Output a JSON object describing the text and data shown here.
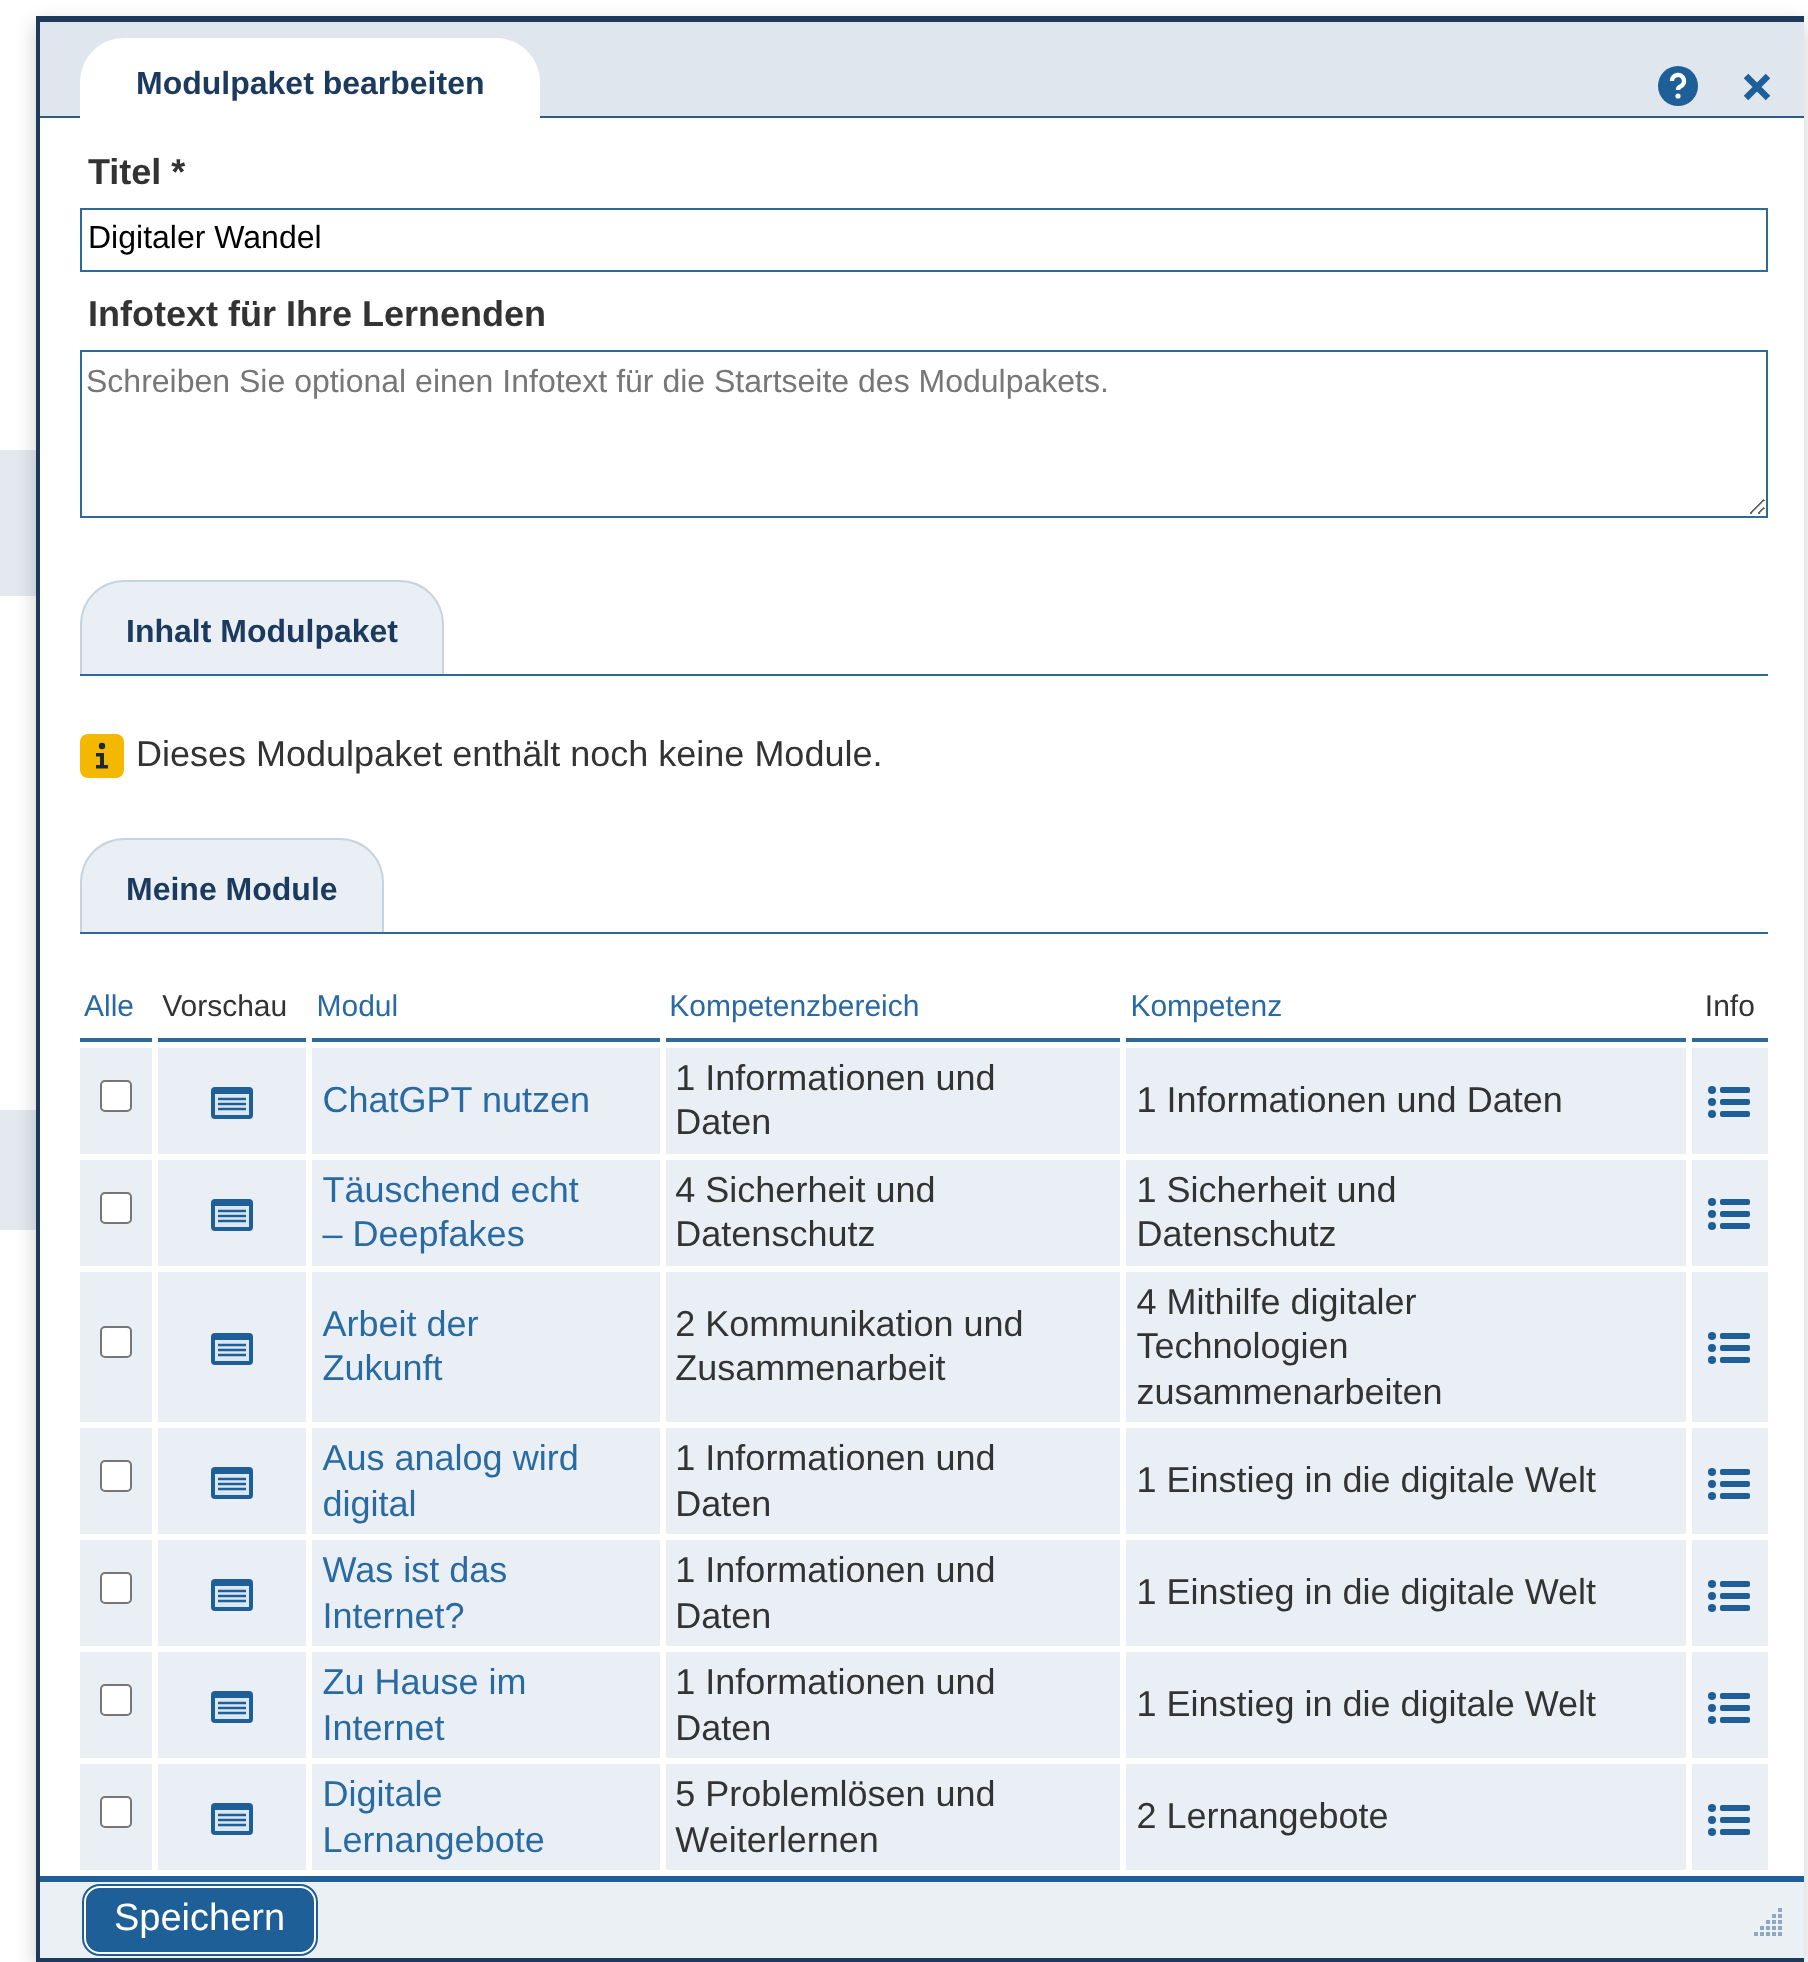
{
  "dialog": {
    "title": "Modulpaket bearbeiten"
  },
  "form": {
    "title_label": "Titel *",
    "title_value": "Digitaler Wandel",
    "info_label": "Infotext für Ihre Lernenden",
    "info_placeholder": "Schreiben Sie optional einen Infotext für die Startseite des Modulpakets."
  },
  "content_tab": {
    "label": "Inhalt Modulpaket"
  },
  "notice": "Dieses Modulpaket enthält noch keine Module.",
  "modules_tab": {
    "label": "Meine Module"
  },
  "table": {
    "columns": [
      "Alle",
      "Vorschau",
      "Modul",
      "Kompetenzbereich",
      "Kompetenz",
      "Info"
    ],
    "rows": [
      {
        "checked": false,
        "module": "ChatGPT nutzen",
        "area": "1 Informationen und Daten",
        "competence": "1 Informationen und Daten"
      },
      {
        "checked": false,
        "module": "Täuschend echt – Deepfakes",
        "area": "4 Sicherheit und Datenschutz",
        "competence": "1 Sicherheit und Datenschutz"
      },
      {
        "checked": false,
        "module": "Arbeit der Zukunft",
        "area": "2 Kommunikation und Zusammenarbeit",
        "competence": "4 Mithilfe digitaler Technologien zusammenarbeiten"
      },
      {
        "checked": false,
        "module": "Aus analog wird digital",
        "area": "1 Informationen und Daten",
        "competence": "1 Einstieg in die digitale Welt"
      },
      {
        "checked": false,
        "module": "Was ist das Internet?",
        "area": "1 Informationen und Daten",
        "competence": "1 Einstieg in die digitale Welt"
      },
      {
        "checked": false,
        "module": "Zu Hause im Internet",
        "area": "1 Informationen und Daten",
        "competence": "1 Einstieg in die digitale Welt"
      },
      {
        "checked": false,
        "module": "Digitale Lernangebote",
        "area": "5 Problemlösen und Weiterlernen",
        "competence": "2 Lernangebote"
      }
    ]
  },
  "save_button": "Speichern"
}
